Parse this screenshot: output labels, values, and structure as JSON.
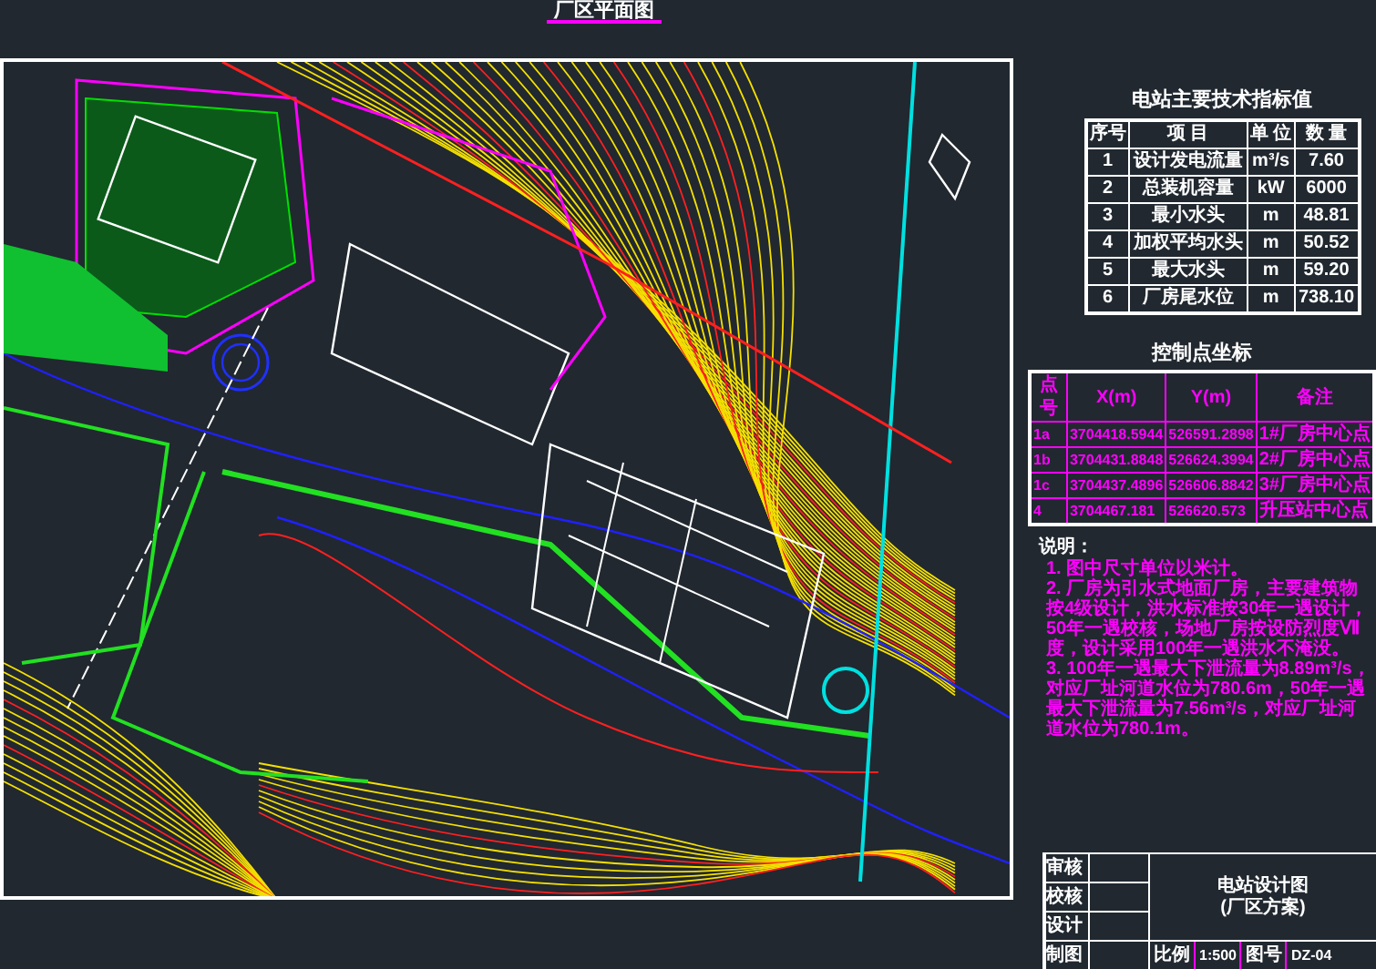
{
  "drawing": {
    "title": "厂区平面图"
  },
  "indicator_table": {
    "title": "电站主要技术指标值",
    "columns": [
      "序号",
      "项 目",
      "单 位",
      "数 量"
    ],
    "rows": [
      [
        "1",
        "设计发电流量",
        "m³/s",
        "7.60"
      ],
      [
        "2",
        "总装机容量",
        "kW",
        "6000"
      ],
      [
        "3",
        "最小水头",
        "m",
        "48.81"
      ],
      [
        "4",
        "加权平均水头",
        "m",
        "50.52"
      ],
      [
        "5",
        "最大水头",
        "m",
        "59.20"
      ],
      [
        "6",
        "厂房尾水位",
        "m",
        "738.10"
      ]
    ]
  },
  "control_table": {
    "title": "控制点坐标",
    "columns": [
      "点号",
      "X(m)",
      "Y(m)",
      "备注"
    ],
    "rows": [
      [
        "1a",
        "3704418.5944",
        "526591.2898",
        "1#厂房中心点"
      ],
      [
        "1b",
        "3704431.8848",
        "526624.3994",
        "2#厂房中心点"
      ],
      [
        "1c",
        "3704437.4896",
        "526606.8842",
        "3#厂房中心点"
      ],
      [
        "4",
        "3704467.181",
        "526620.573",
        "升压站中心点"
      ]
    ]
  },
  "notes": {
    "heading": "说明：",
    "items": [
      "1. 图中尺寸单位以米计。",
      "2. 厂房为引水式地面厂房，主要建筑物按4级设计，洪水标准按30年一遇设计，50年一遇校核，场地厂房按设防烈度Ⅶ度，设计采用100年一遇洪水不淹没。",
      "3. 100年一遇最大下泄流量为8.89m³/s，对应厂址河道水位为780.6m，50年一遇最大下泄流量为7.56m³/s，对应厂址河道水位为780.1m。"
    ]
  },
  "title_block": {
    "roles": [
      "审核",
      "校核",
      "设计",
      "制图"
    ],
    "drawing_name": "电站设计图",
    "subtitle": "(厂区方案)",
    "scale_label": "比例",
    "scale": "1:500",
    "number_label": "图号",
    "number": "DZ-04"
  }
}
